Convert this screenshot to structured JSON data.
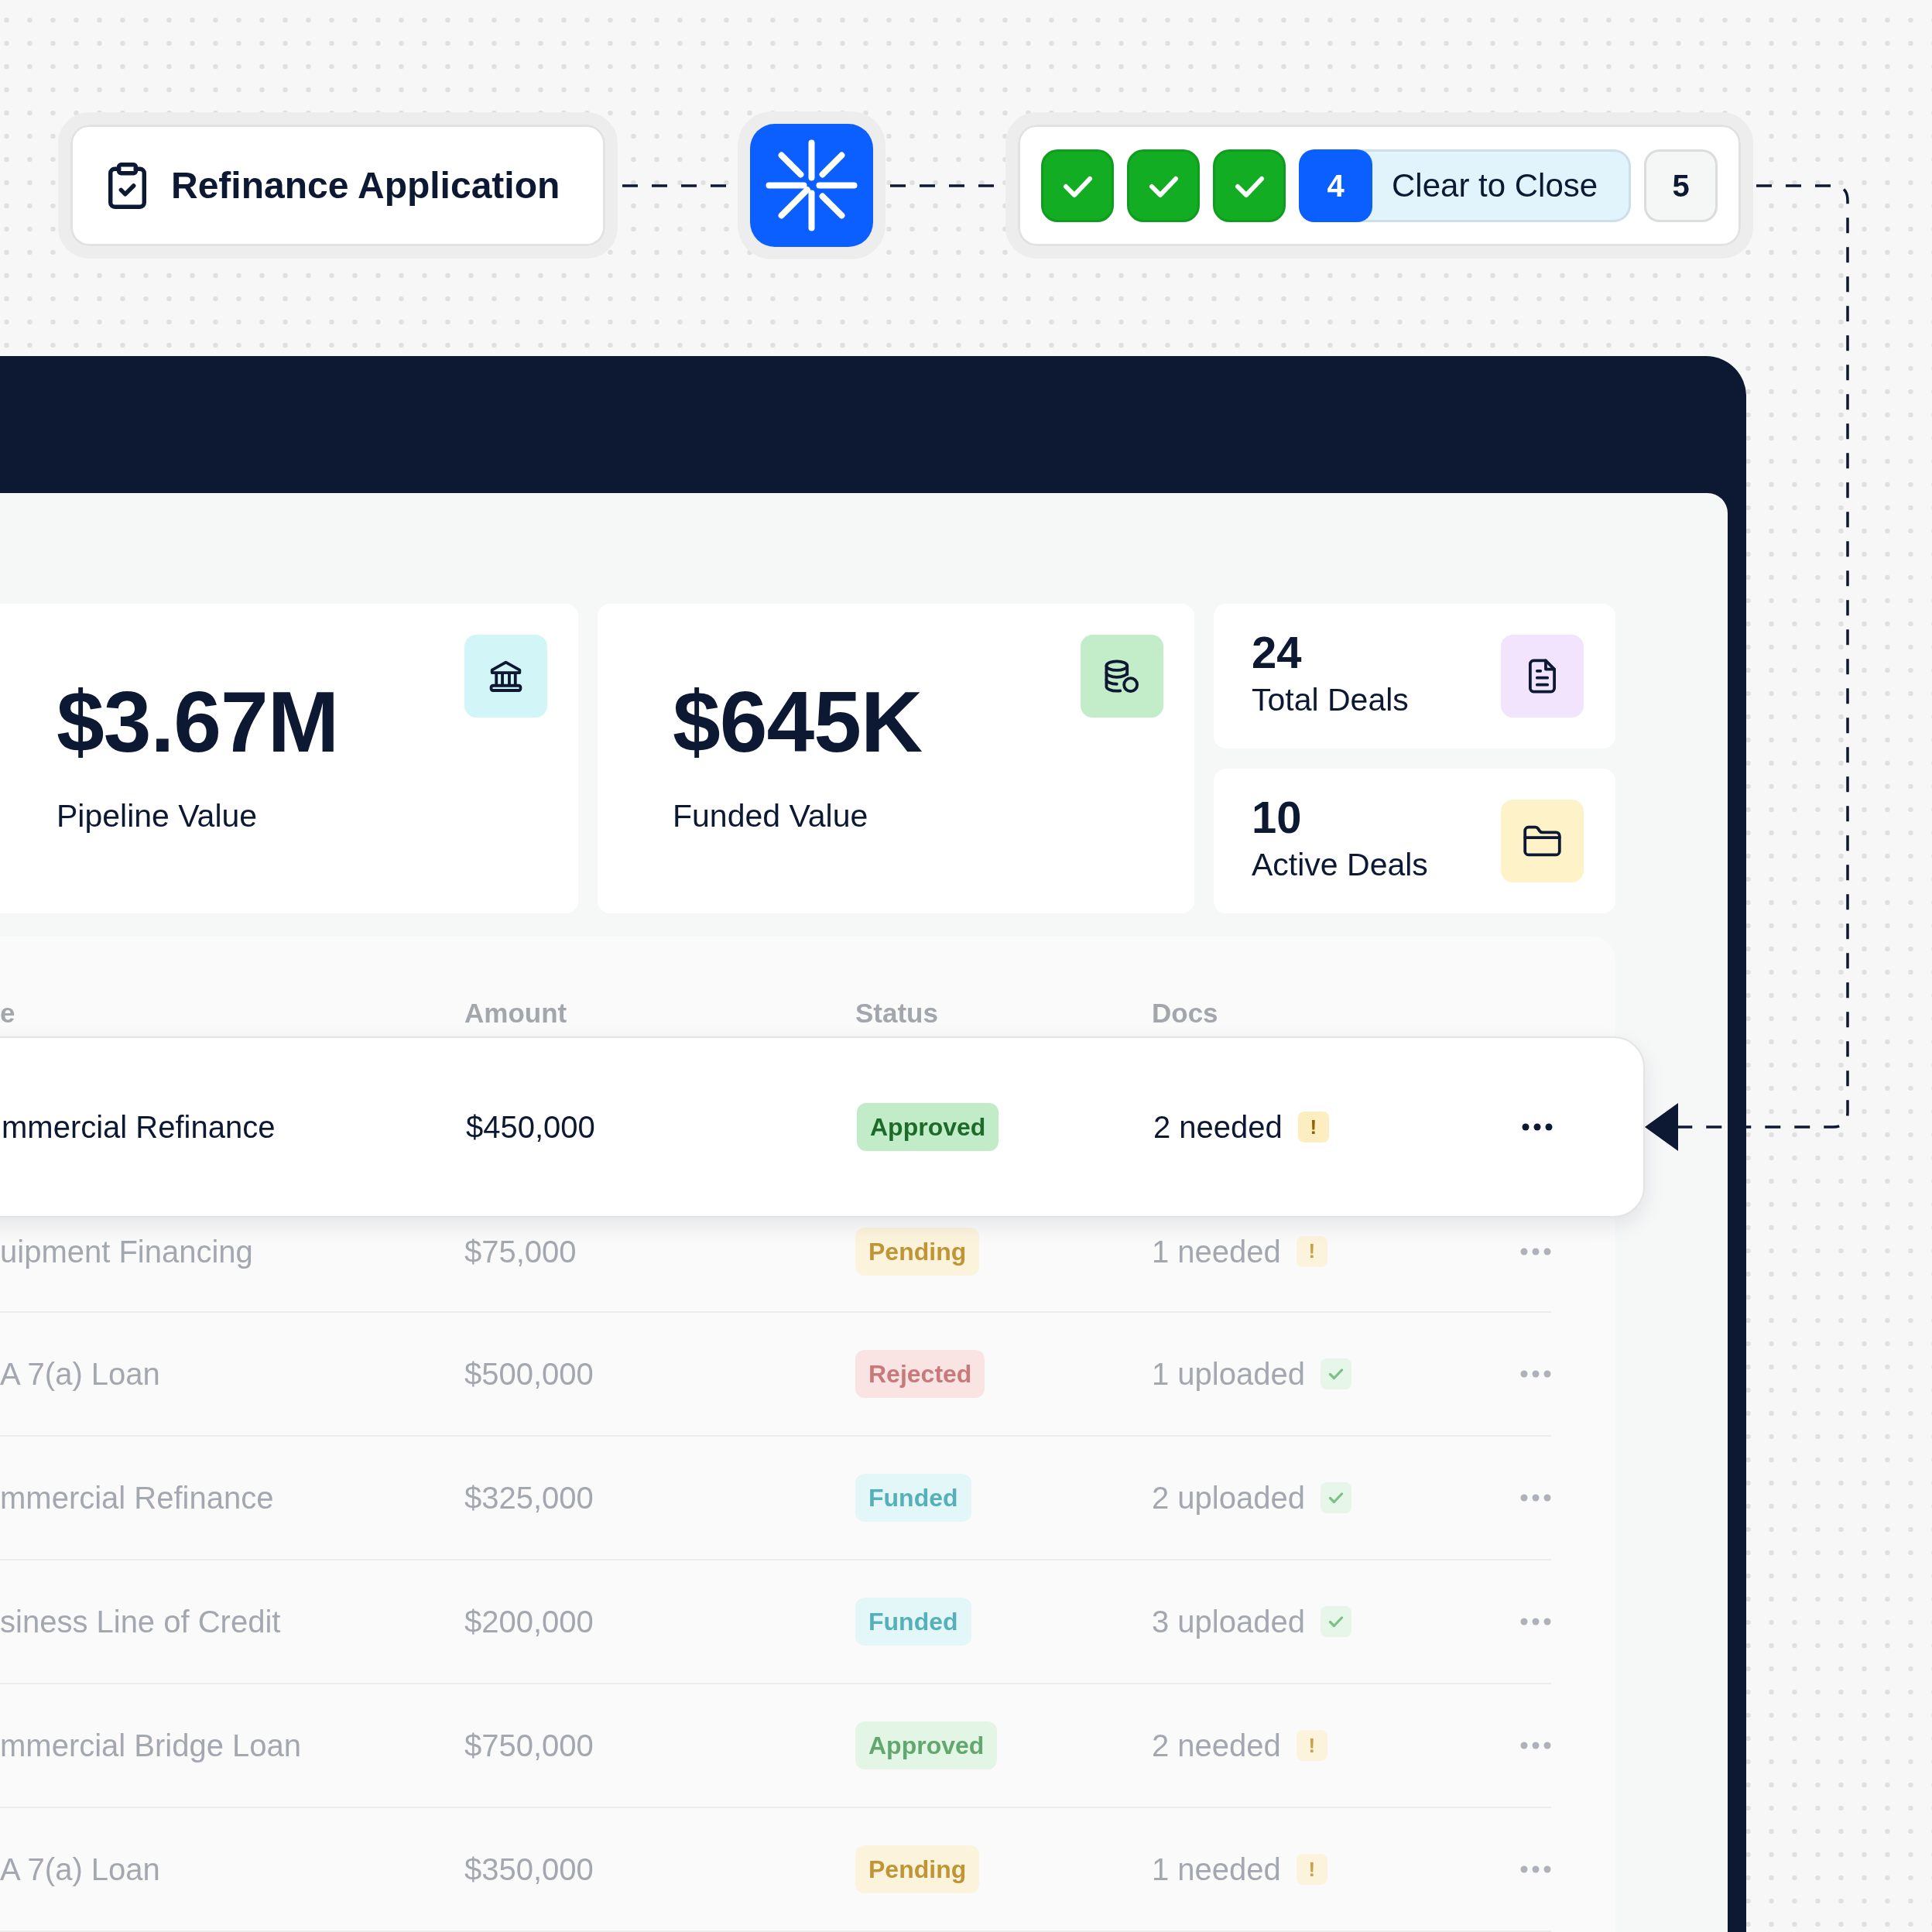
{
  "flow": {
    "application": {
      "title": "Refinance Application"
    },
    "steps": [
      {
        "kind": "done"
      },
      {
        "kind": "done"
      },
      {
        "kind": "done"
      },
      {
        "kind": "current",
        "number": "4",
        "label": "Clear to Close"
      },
      {
        "kind": "upcoming",
        "number": "5"
      }
    ]
  },
  "stats": [
    {
      "kind": "large",
      "value": "$3.67M",
      "label": "Pipeline Value",
      "color": "#d2f5f7"
    },
    {
      "kind": "large",
      "value": "$645K",
      "label": "Funded Value",
      "color": "#c3ecc9"
    },
    {
      "kind": "compact",
      "value": "24",
      "label": "Total Deals",
      "color": "#f1e4fc"
    },
    {
      "kind": "compact",
      "value": "10",
      "label": "Active Deals",
      "color": "#fdf2c8"
    }
  ],
  "table": {
    "columns": [
      {
        "label": "e"
      },
      {
        "label": "Amount"
      },
      {
        "label": "Status"
      },
      {
        "label": "Docs"
      }
    ],
    "rows": [
      {
        "selected": true,
        "name": "mmercial Refinance",
        "amount": "$450,000",
        "status": {
          "label": "Approved",
          "kind": "approved"
        },
        "docs": {
          "label": "2 needed",
          "kind": "needed",
          "badge": "!"
        }
      },
      {
        "selected": false,
        "name": "uipment Financing",
        "amount": "$75,000",
        "status": {
          "label": "Pending",
          "kind": "pending"
        },
        "docs": {
          "label": "1 needed",
          "kind": "needed",
          "badge": "!"
        }
      },
      {
        "selected": false,
        "name": "A 7(a) Loan",
        "amount": "$500,000",
        "status": {
          "label": "Rejected",
          "kind": "rejected"
        },
        "docs": {
          "label": "1 uploaded",
          "kind": "uploaded"
        }
      },
      {
        "selected": false,
        "name": "mmercial Refinance",
        "amount": "$325,000",
        "status": {
          "label": "Funded",
          "kind": "funded"
        },
        "docs": {
          "label": "2 uploaded",
          "kind": "uploaded"
        }
      },
      {
        "selected": false,
        "name": "siness Line of Credit",
        "amount": "$200,000",
        "status": {
          "label": "Funded",
          "kind": "funded"
        },
        "docs": {
          "label": "3 uploaded",
          "kind": "uploaded"
        }
      },
      {
        "selected": false,
        "name": "mmercial Bridge Loan",
        "amount": "$750,000",
        "status": {
          "label": "Approved",
          "kind": "approved"
        },
        "docs": {
          "label": "2 needed",
          "kind": "needed",
          "badge": "!"
        }
      },
      {
        "selected": false,
        "name": "A 7(a) Loan",
        "amount": "$350,000",
        "status": {
          "label": "Pending",
          "kind": "pending"
        },
        "docs": {
          "label": "1 needed",
          "kind": "needed",
          "badge": "!"
        }
      }
    ]
  }
}
